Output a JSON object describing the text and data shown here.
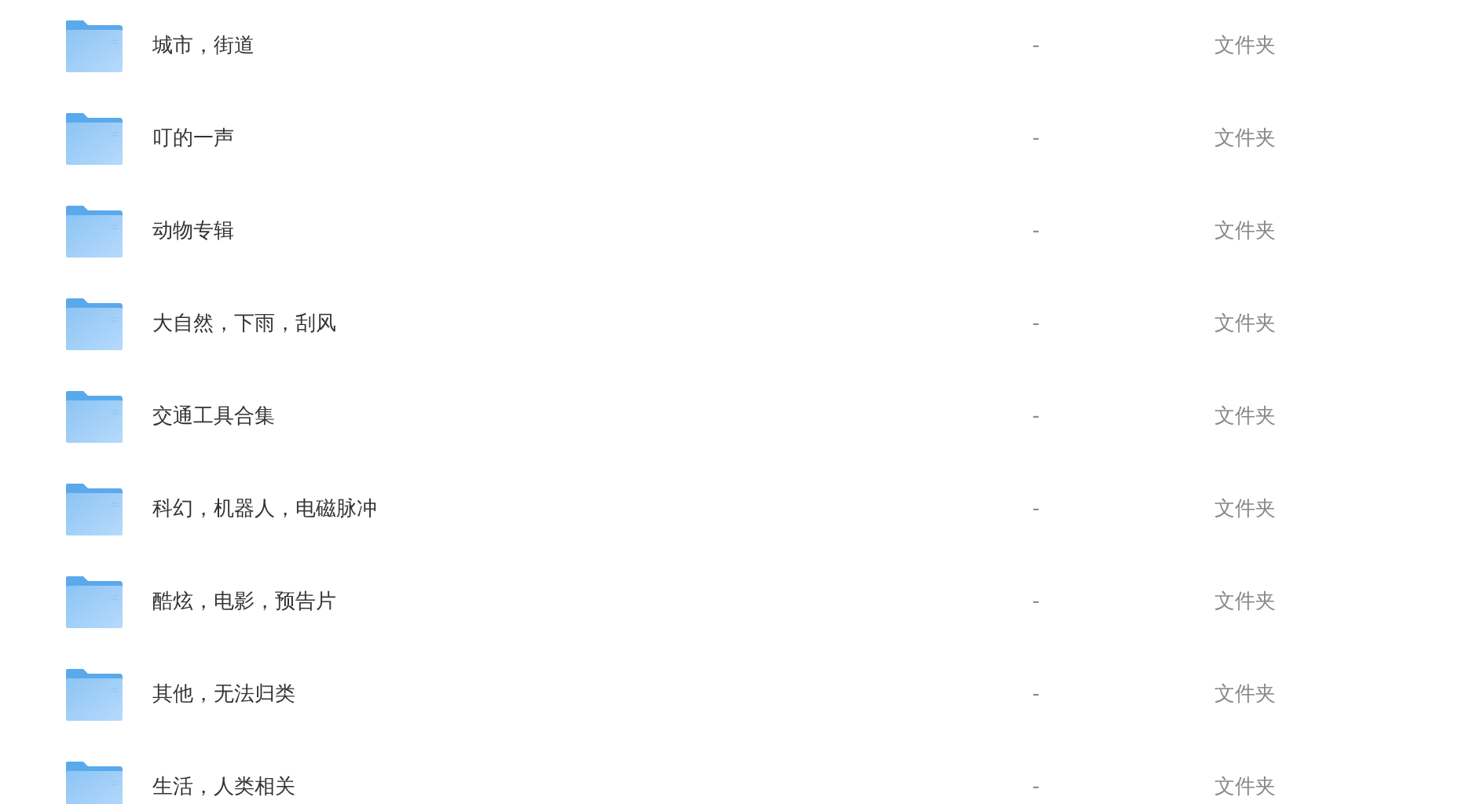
{
  "files": [
    {
      "name": "城市，街道",
      "size": "-",
      "type": "文件夹"
    },
    {
      "name": "叮的一声",
      "size": "-",
      "type": "文件夹"
    },
    {
      "name": "动物专辑",
      "size": "-",
      "type": "文件夹"
    },
    {
      "name": "大自然，下雨，刮风",
      "size": "-",
      "type": "文件夹"
    },
    {
      "name": "交通工具合集",
      "size": "-",
      "type": "文件夹"
    },
    {
      "name": "科幻，机器人，电磁脉冲",
      "size": "-",
      "type": "文件夹"
    },
    {
      "name": "酷炫，电影，预告片",
      "size": "-",
      "type": "文件夹"
    },
    {
      "name": "其他，无法归类",
      "size": "-",
      "type": "文件夹"
    },
    {
      "name": "生活，人类相关",
      "size": "-",
      "type": "文件夹"
    }
  ]
}
